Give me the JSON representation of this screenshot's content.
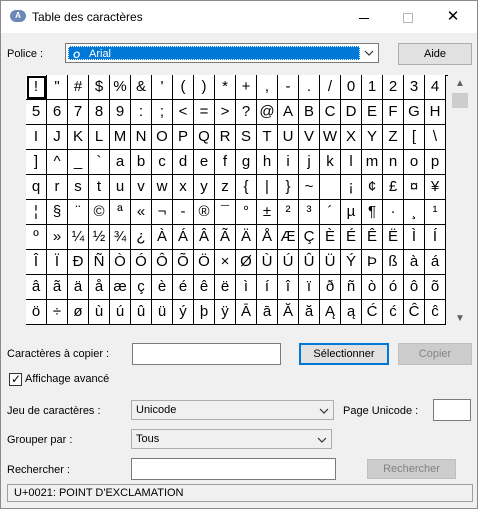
{
  "window": {
    "title": "Table des caractères",
    "icon_text": "A",
    "minimize_icon": "minimize-icon",
    "maximize_icon": "maximize-icon",
    "close_glyph": "✕"
  },
  "font_row": {
    "label": "Police :",
    "selected_font": "Arial",
    "font_type_icon": "O",
    "help_button": "Aide"
  },
  "grid": {
    "columns": 20,
    "selected_index": 0,
    "rows": [
      [
        "!",
        "\"",
        "#",
        "$",
        "%",
        "&",
        "'",
        "(",
        ")",
        "*",
        "+",
        ",",
        "-",
        ".",
        "/",
        "0",
        "1",
        "2",
        "3",
        "4"
      ],
      [
        "5",
        "6",
        "7",
        "8",
        "9",
        ":",
        ";",
        "<",
        "=",
        ">",
        "?",
        "@",
        "A",
        "B",
        "C",
        "D",
        "E",
        "F",
        "G",
        "H"
      ],
      [
        "I",
        "J",
        "K",
        "L",
        "M",
        "N",
        "O",
        "P",
        "Q",
        "R",
        "S",
        "T",
        "U",
        "V",
        "W",
        "X",
        "Y",
        "Z",
        "[",
        "\\"
      ],
      [
        "]",
        "^",
        "_",
        "`",
        "a",
        "b",
        "c",
        "d",
        "e",
        "f",
        "g",
        "h",
        "i",
        "j",
        "k",
        "l",
        "m",
        "n",
        "o",
        "p"
      ],
      [
        "q",
        "r",
        "s",
        "t",
        "u",
        "v",
        "w",
        "x",
        "y",
        "z",
        "{",
        "|",
        "}",
        "~",
        " ",
        "¡",
        "¢",
        "£",
        "¤",
        "¥"
      ],
      [
        "¦",
        "§",
        "¨",
        "©",
        "ª",
        "«",
        "¬",
        "-",
        "®",
        "¯",
        "°",
        "±",
        "²",
        "³",
        "´",
        "µ",
        "¶",
        "·",
        "¸",
        "¹"
      ],
      [
        "º",
        "»",
        "¼",
        "½",
        "¾",
        "¿",
        "À",
        "Á",
        "Â",
        "Ã",
        "Ä",
        "Å",
        "Æ",
        "Ç",
        "È",
        "É",
        "Ê",
        "Ë",
        "Ì",
        "Í"
      ],
      [
        "Î",
        "Ï",
        "Ð",
        "Ñ",
        "Ò",
        "Ó",
        "Ô",
        "Õ",
        "Ö",
        "×",
        "Ø",
        "Ù",
        "Ú",
        "Û",
        "Ü",
        "Ý",
        "Þ",
        "ß",
        "à",
        "á"
      ],
      [
        "â",
        "ã",
        "ä",
        "å",
        "æ",
        "ç",
        "è",
        "é",
        "ê",
        "ë",
        "ì",
        "í",
        "î",
        "ï",
        "ð",
        "ñ",
        "ò",
        "ó",
        "ô",
        "õ"
      ],
      [
        "ö",
        "÷",
        "ø",
        "ù",
        "ú",
        "û",
        "ü",
        "ý",
        "þ",
        "ÿ",
        "Ā",
        "ā",
        "Ă",
        "ă",
        "Ą",
        "ą",
        "Ć",
        "ć",
        "Ĉ",
        "ĉ"
      ]
    ]
  },
  "scrollbar": {
    "up_glyph": "▲",
    "down_glyph": "▼"
  },
  "copy_row": {
    "label": "Caractères à copier :",
    "value": "",
    "select_button": "Sélectionner",
    "copy_button": "Copier"
  },
  "advanced": {
    "label": "Affichage avancé",
    "checked": true,
    "check_glyph": "✓"
  },
  "charset_row": {
    "label": "Jeu de caractères :",
    "value": "Unicode",
    "unicode_page_label": "Page Unicode :",
    "unicode_page_value": ""
  },
  "group_row": {
    "label": "Grouper par :",
    "value": "Tous"
  },
  "search_row": {
    "label": "Rechercher :",
    "value": "",
    "search_button": "Rechercher"
  },
  "status": {
    "text": "U+0021: POINT D'EXCLAMATION"
  }
}
